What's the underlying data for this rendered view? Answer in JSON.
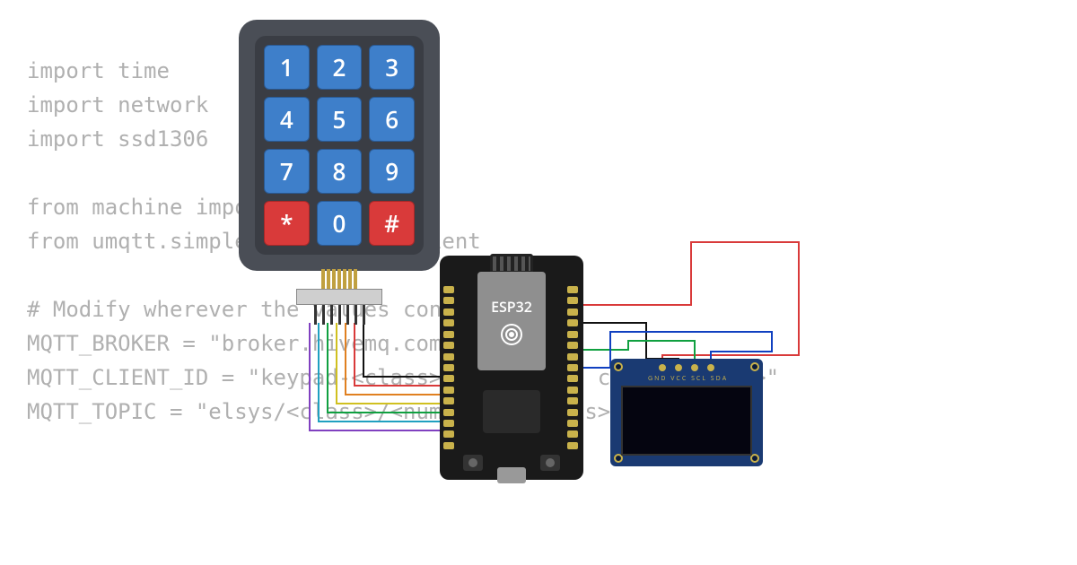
{
  "code": {
    "lines": [
      "import time",
      "import network",
      "import ssd1306",
      "",
      "from machine import Pin",
      "from umqtt.simple import MQTTClient",
      "",
      "# Modify wherever the values contain < >",
      "MQTT_BROKER = \"broker.hivemq.com\"",
      "MQTT_CLIENT_ID = \"keypad-<class>-<number in class>-<name>\"",
      "MQTT_TOPIC = \"elsys/<class>/<number in class>/<name>\""
    ]
  },
  "keypad": {
    "keys": [
      {
        "label": "1",
        "color": "blue"
      },
      {
        "label": "2",
        "color": "blue"
      },
      {
        "label": "3",
        "color": "blue"
      },
      {
        "label": "4",
        "color": "blue"
      },
      {
        "label": "5",
        "color": "blue"
      },
      {
        "label": "6",
        "color": "blue"
      },
      {
        "label": "7",
        "color": "blue"
      },
      {
        "label": "8",
        "color": "blue"
      },
      {
        "label": "9",
        "color": "blue"
      },
      {
        "label": "*",
        "color": "red"
      },
      {
        "label": "0",
        "color": "blue"
      },
      {
        "label": "#",
        "color": "red"
      }
    ]
  },
  "board": {
    "label": "ESP32"
  },
  "oled": {
    "pin_labels": "GND VCC SCL SDA"
  },
  "wires": {
    "colors": {
      "red": "#d93a3a",
      "black": "#111111",
      "blue": "#1040c0",
      "green": "#10a040",
      "orange": "#e08020",
      "yellow": "#d0c020",
      "purple": "#8040c0",
      "cyan": "#20a0c0"
    }
  }
}
